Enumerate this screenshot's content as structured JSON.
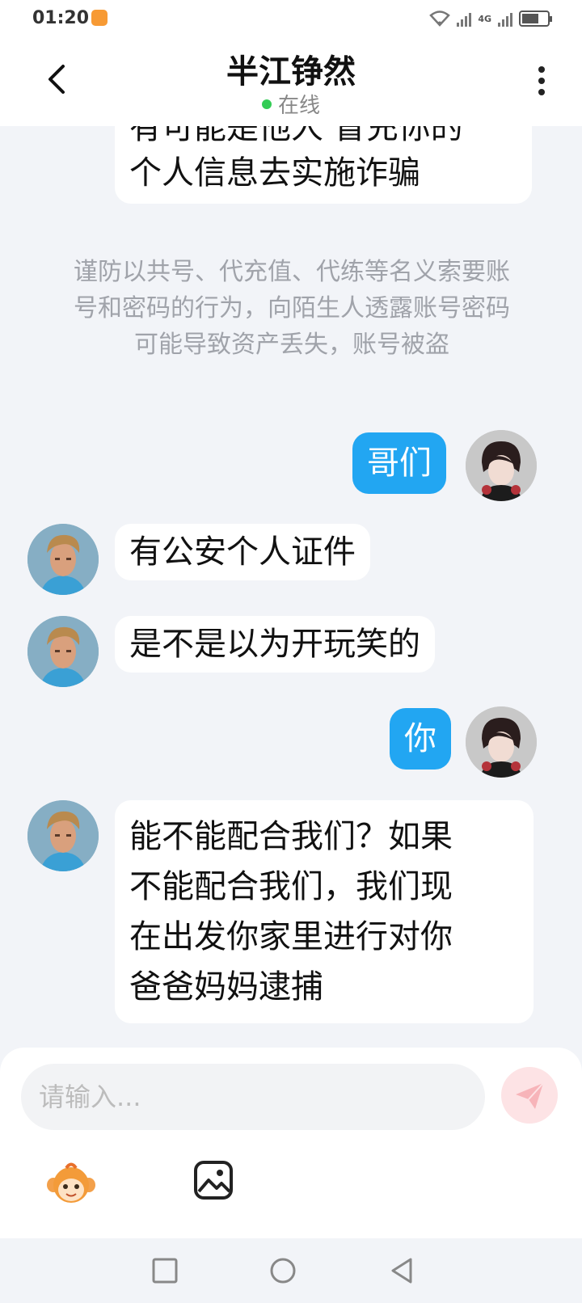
{
  "status_bar": {
    "time": "01:20",
    "network": "4G"
  },
  "header": {
    "title": "半江铮然",
    "status": "在线"
  },
  "messages": [
    {
      "from": "other",
      "text_line1": "有可能是他人 冒充你的",
      "text_line2": "个人信息去实施诈骗"
    },
    {
      "type": "notice",
      "text": "谨防以共号、代充值、代练等名义索要账号和密码的行为，向陌生人透露账号密码可能导致资产丢失，账号被盗"
    },
    {
      "from": "me",
      "text": "哥们"
    },
    {
      "from": "other",
      "text": "有公安个人证件"
    },
    {
      "from": "other",
      "text": "是不是以为开玩笑的"
    },
    {
      "from": "me",
      "text": "你"
    },
    {
      "from": "other",
      "lines": [
        "能不能配合我们？如果",
        "不能配合我们，我们现",
        "在出发你家里进行对你",
        "爸爸妈妈逮捕"
      ]
    }
  ],
  "input": {
    "placeholder": "请输入..."
  },
  "colors": {
    "accent_blue": "#22a6f2",
    "online_green": "#33cc55",
    "send_disabled": "#fde3e5"
  }
}
